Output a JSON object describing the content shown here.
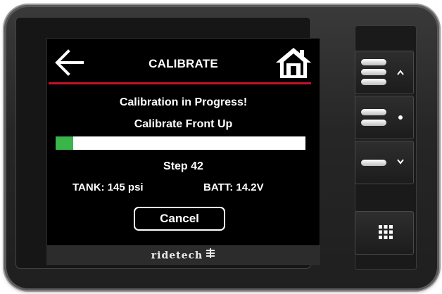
{
  "screen": {
    "title": "CALIBRATE",
    "status_message": "Calibration in Progress!",
    "task_label": "Calibrate Front Up",
    "progress": 0.07,
    "step_label": "Step 42",
    "tank_label": "TANK: 145 psi",
    "batt_label": "BATT: 14.2V",
    "cancel_label": "Cancel",
    "back_icon": "back-arrow-icon",
    "home_icon": "home-icon"
  },
  "brand": {
    "name": "ridetech"
  },
  "colors": {
    "accent_red": "#c8102e",
    "progress_green": "#39b54a",
    "screen_bg": "#000000",
    "text": "#ffffff"
  },
  "hardware_buttons": [
    {
      "name": "preset-up-button",
      "icon": "three-bars-up-icon"
    },
    {
      "name": "preset-middle-button",
      "icon": "two-bars-dot-icon"
    },
    {
      "name": "preset-down-button",
      "icon": "one-bar-down-icon"
    },
    {
      "name": "menu-button",
      "icon": "grid-icon"
    }
  ]
}
